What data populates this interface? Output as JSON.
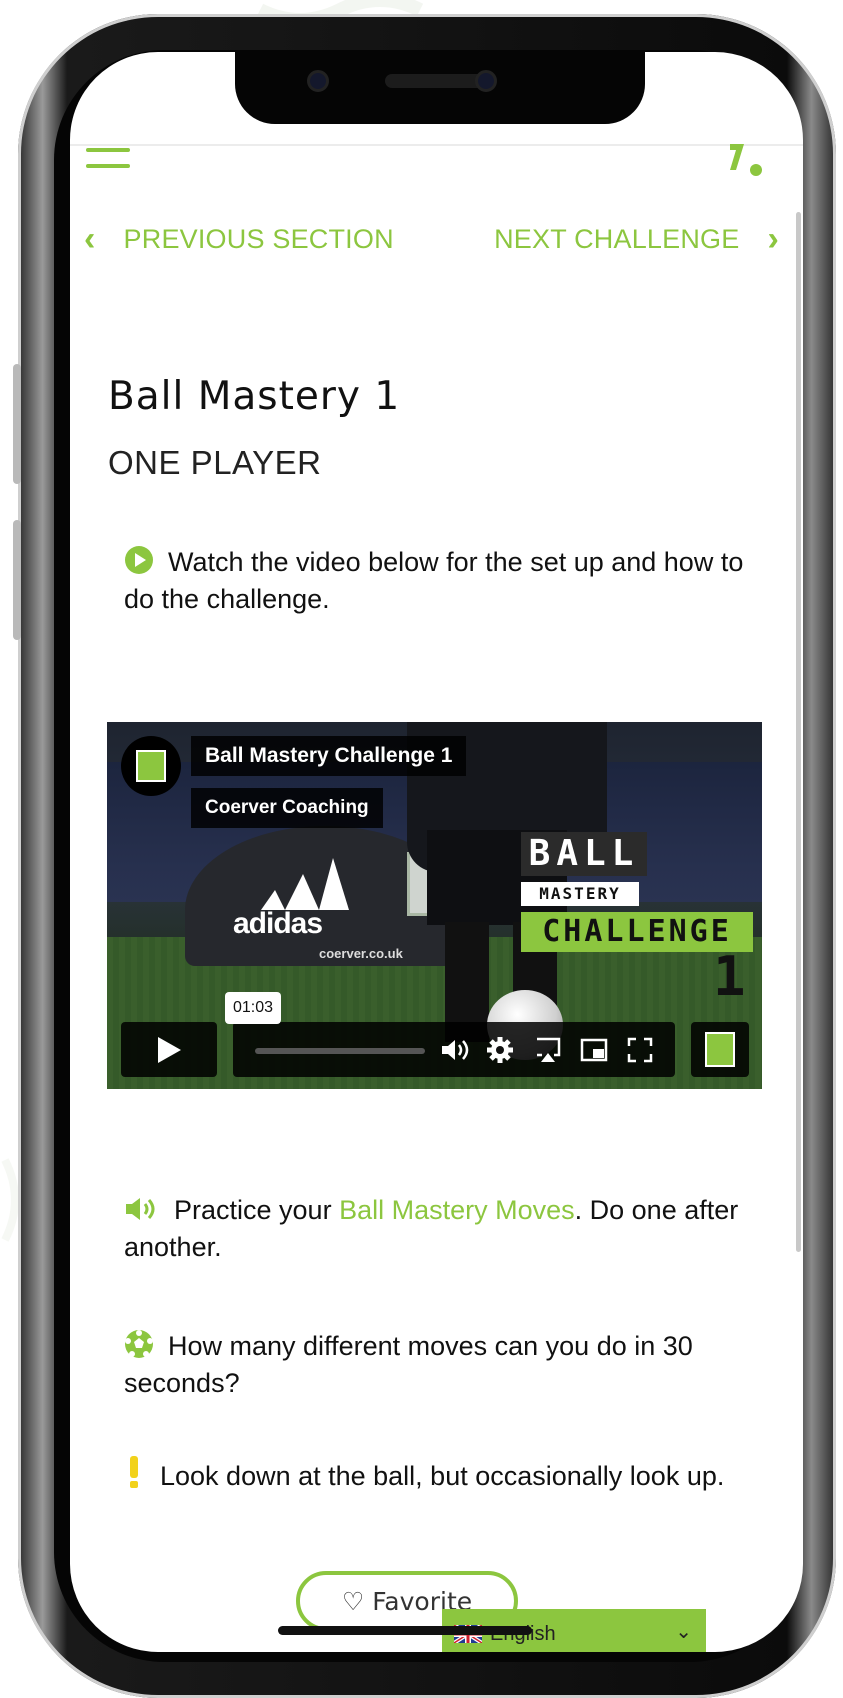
{
  "colors": {
    "accent": "#8cc63f",
    "text": "#111111",
    "warning": "#f2d21b"
  },
  "nav": {
    "menu_icon": "hamburger-icon",
    "prev_label": "PREVIOUS SECTION",
    "next_label": "NEXT CHALLENGE"
  },
  "challenge": {
    "title": "Ball Mastery 1",
    "subtitle": "ONE PLAYER"
  },
  "instructions": {
    "watch": "Watch the video below for the set up and how to do the challenge."
  },
  "video": {
    "title": "Ball Mastery Challenge 1",
    "channel": "Coerver Coaching",
    "duration": "01:03",
    "overlay_line1": "BALL",
    "overlay_line2": "MASTERY",
    "overlay_line3": "CHALLENGE",
    "overlay_line4": "1",
    "banner_brand": "adidas",
    "banner_url": "coerver.co.uk",
    "controls": [
      "play-icon",
      "volume-icon",
      "settings-icon",
      "airplay-icon",
      "picture-in-picture-icon",
      "fullscreen-icon"
    ]
  },
  "tips": {
    "practice_prefix": "Practice your ",
    "practice_link": "Ball Mastery Moves",
    "practice_suffix": ". Do one after another.",
    "question": "How many different moves can you do in 30 seconds?",
    "tip": "Look down at the ball, but occasionally look up."
  },
  "favorite_label": "♡ Favorite",
  "language": {
    "label": "English",
    "flag": "uk-flag-icon"
  }
}
